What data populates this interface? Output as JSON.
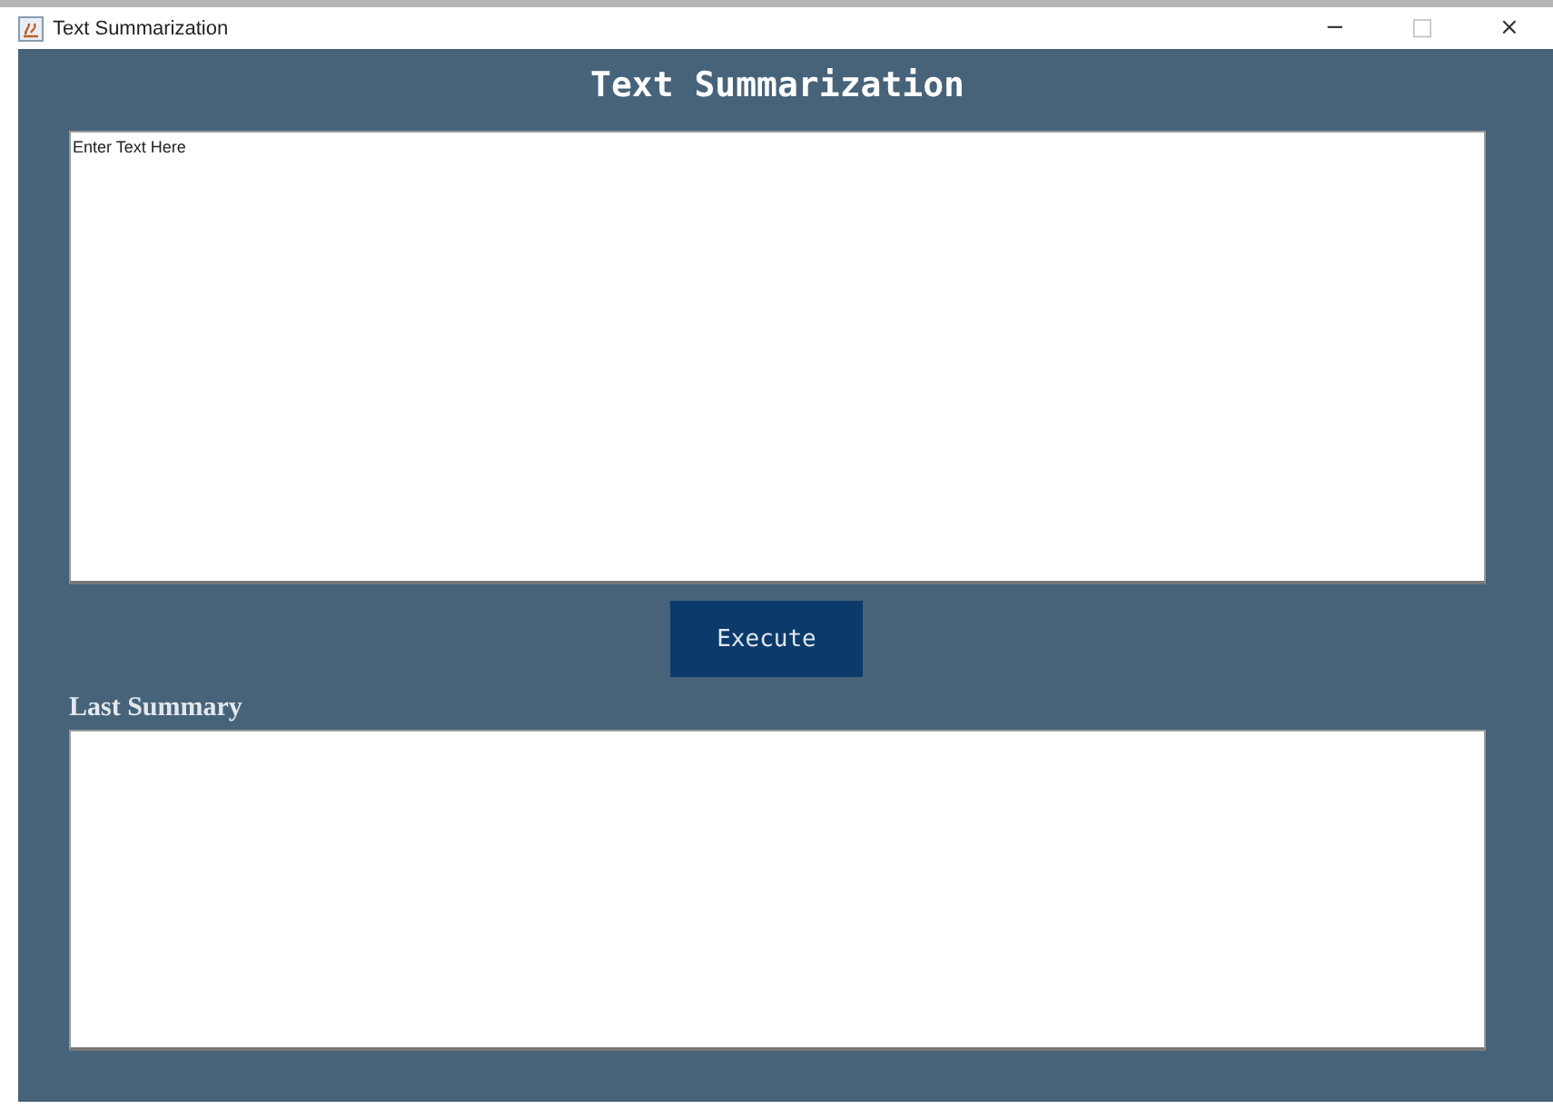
{
  "window": {
    "title": "Text Summarization",
    "controls": [
      "−",
      "□",
      "×"
    ]
  },
  "heading": "Text Summarization",
  "input": {
    "value": "Enter Text Here"
  },
  "button": "Execute",
  "summary": {
    "label": "Last Summary"
  }
}
